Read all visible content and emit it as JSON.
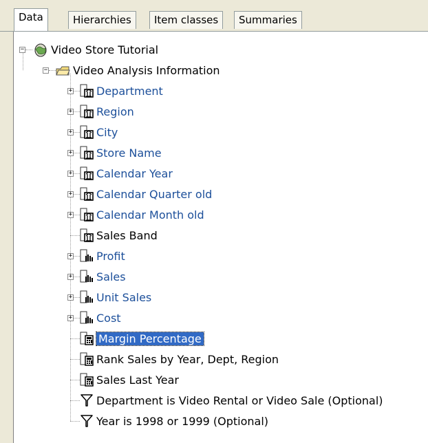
{
  "tabs": [
    "Data",
    "Hierarchies",
    "Item classes",
    "Summaries"
  ],
  "active_tab": "Data",
  "tree": {
    "root": "Video Store Tutorial",
    "folder": "Video Analysis Information",
    "items": [
      {
        "label": "Department",
        "icon": "dimension-icon",
        "expandable": true
      },
      {
        "label": "Region",
        "icon": "dimension-icon",
        "expandable": true
      },
      {
        "label": "City",
        "icon": "dimension-icon",
        "expandable": true
      },
      {
        "label": "Store Name",
        "icon": "dimension-icon",
        "expandable": true
      },
      {
        "label": "Calendar Year",
        "icon": "dimension-icon",
        "expandable": true
      },
      {
        "label": "Calendar Quarter old",
        "icon": "dimension-icon",
        "expandable": true
      },
      {
        "label": "Calendar Month old",
        "icon": "dimension-icon",
        "expandable": true
      },
      {
        "label": "Sales Band",
        "icon": "dimension-icon",
        "expandable": false
      },
      {
        "label": "Profit",
        "icon": "measure-icon",
        "expandable": true
      },
      {
        "label": "Sales",
        "icon": "measure-icon",
        "expandable": true
      },
      {
        "label": "Unit Sales",
        "icon": "measure-icon",
        "expandable": true
      },
      {
        "label": "Cost",
        "icon": "measure-icon",
        "expandable": true
      },
      {
        "label": "Margin Percentage",
        "icon": "calculation-icon",
        "expandable": false,
        "selected": true
      },
      {
        "label": "Rank Sales by Year, Dept, Region",
        "icon": "calculation-icon",
        "expandable": false
      },
      {
        "label": "Sales Last Year",
        "icon": "calculation-icon",
        "expandable": false
      },
      {
        "label": "Department is Video Rental or Video Sale (Optional)",
        "icon": "filter-icon",
        "expandable": false
      },
      {
        "label": "Year is 1998 or 1999 (Optional)",
        "icon": "filter-icon",
        "expandable": false
      }
    ]
  }
}
